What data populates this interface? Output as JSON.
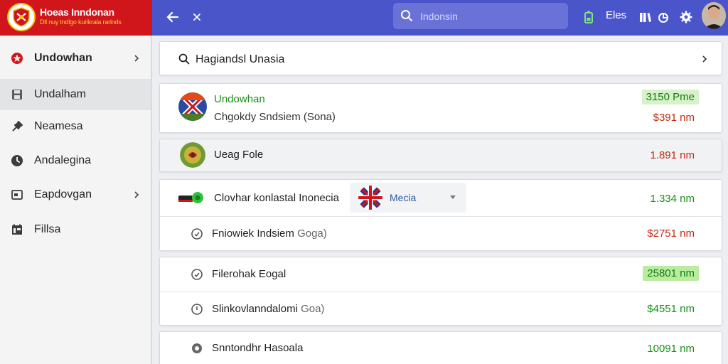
{
  "header": {
    "brand_title": "Hoeas Inndonan",
    "brand_subtitle": "Dll nuy tndlgo kurikrala rarlnds",
    "search_placeholder": "Indonsin",
    "files_label": "Eles"
  },
  "sidebar": {
    "items": [
      {
        "label": "Undowhan",
        "icon": "star-badge-icon",
        "has_chevron": true,
        "active": false
      },
      {
        "label": "Undalham",
        "icon": "save-icon",
        "has_chevron": false,
        "active": true
      },
      {
        "label": "Neamesa",
        "icon": "pin-icon",
        "has_chevron": false,
        "active": false
      },
      {
        "label": "Andalegina",
        "icon": "clock-icon",
        "has_chevron": false,
        "active": false
      },
      {
        "label": "Eapdovgan",
        "icon": "folder-icon",
        "has_chevron": true,
        "active": false
      },
      {
        "label": "Fillsa",
        "icon": "calendar-icon",
        "has_chevron": false,
        "active": false
      }
    ]
  },
  "main": {
    "search_text": "Hagiandsl Unasia",
    "card1": {
      "title": "Undowhan",
      "subtitle": "Chgokdy Sndsiem (Sona)",
      "badge": "3150 Pme",
      "amount": "$391 nm"
    },
    "card2": {
      "title": "Ueag Fole",
      "amount": "1.891 nm"
    },
    "card3": {
      "title": "Clovhar konlastal Inonecia",
      "select_value": "Mecia",
      "amount": "1.334 nm",
      "row2_title": "Fniowiek Indsiem",
      "row2_suffix": "Goga)",
      "row2_amount": "$2751 nm"
    },
    "card4": {
      "row1_title": "Filerohak Eogal",
      "row1_amount": "25801 nm",
      "row2_title": "Slinkovlanndalomi",
      "row2_suffix": "Goa)",
      "row2_amount": "$4551 nm"
    },
    "card5": {
      "row1_title": "Snntondhr Hasoala",
      "row1_amount": "10091 nm"
    }
  },
  "colors": {
    "brand_red": "#d0151b",
    "topbar_blue": "#4a55c9",
    "positive_green": "#1a8f1a",
    "negative_red": "#c22b14"
  }
}
